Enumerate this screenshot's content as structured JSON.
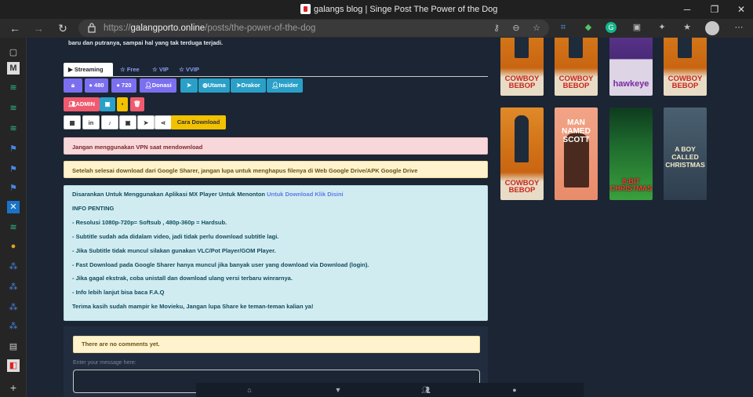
{
  "window": {
    "title": "galangs blog | Singe Post The Power of the Dog",
    "minimize": "─",
    "maximize": "❐",
    "close": "✕"
  },
  "addressbar": {
    "url_scheme": "https://",
    "url_host": "galangporto.online",
    "url_path": "/posts/the-power-of-the-dog"
  },
  "intro_text": "baru dan putranya, sampai hal yang tak terduga terjadi.",
  "tabs": [
    {
      "label": "Streaming",
      "icon": "video-icon"
    },
    {
      "label": "Free",
      "icon": "star-icon"
    },
    {
      "label": "VIP",
      "icon": "star-icon"
    },
    {
      "label": "VVIP",
      "icon": "star-icon"
    }
  ],
  "buttons_row1": [
    {
      "label": "",
      "icon": "lock-icon"
    },
    {
      "label": "480",
      "icon": "play-icon"
    },
    {
      "label": "720",
      "icon": "play-icon"
    },
    {
      "label": "Donasi",
      "icon": "user-icon"
    },
    {
      "label": "",
      "icon": "telegram-icon"
    },
    {
      "label": "Utama",
      "icon": "globe-icon"
    },
    {
      "label": "Drakor",
      "icon": "telegram-icon"
    },
    {
      "label": "Insider",
      "icon": "user-icon"
    }
  ],
  "buttons_row2": [
    {
      "label": "ADMIN",
      "icon": "users-icon"
    }
  ],
  "share_buttons": {
    "download_label": "Cara Download"
  },
  "alerts": {
    "vpn": "Jangan menggunakan VPN saat mendownload",
    "delete": "Setelah selesai download dari Google Sharer, jangan lupa untuk menghapus filenya di Web Google Drive/APK Google Drive",
    "info_intro": "Disarankan Untuk Menggunakan Aplikasi MX Player Untuk Menonton ",
    "info_link": "Untuk Download Klik Disini",
    "info_heading": "INFO PENTING",
    "info_lines": [
      "- Resolusi 1080p-720p= Softsub , 480p-360p = Hardsub.",
      "- Subtitle sudah ada didalam video, jadi tidak perlu download subtitle lagi.",
      "- Jika Subtitle tidak muncul silakan gunakan VLC/Pot Player/GOM Player.",
      "- Fast Download pada Google Sharer hanya muncul jika banyak user yang download via Download (login).",
      "- Jika gagal ekstrak, coba unistall dan download ulang versi terbaru winrarnya.",
      "- Info lebih lanjut bisa baca F.A.Q"
    ],
    "info_thanks": "Terima kasih sudah mampir ke Movieku, Jangan lupa Share ke teman-teman kalian ya!"
  },
  "comments": {
    "empty": "There are no comments yet.",
    "label": "Enter your message here:"
  },
  "posters": [
    {
      "title": "COWBOY BEBOP"
    },
    {
      "title": "COWBOY BEBOP"
    },
    {
      "title": "hawkeye"
    },
    {
      "title": "COWBOY BEBOP"
    },
    {
      "title": "COWBOY BEBOP"
    },
    {
      "title": "MAN NAMED SCOTT"
    },
    {
      "title": "8-BIT CHRISTMAS"
    },
    {
      "title": "A BOY CALLED CHRISTMAS"
    }
  ]
}
